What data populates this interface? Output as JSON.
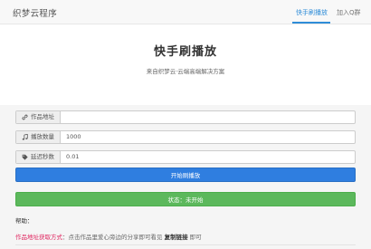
{
  "navbar": {
    "brand": "织梦云程序",
    "active_link": "快手刷播放",
    "other_link": "加入Q群"
  },
  "header": {
    "title": "快手刷播放",
    "subtitle": "来自织梦云·云端高端解决方案"
  },
  "form": {
    "work_url": {
      "label": "作品地址",
      "value": "",
      "icon": "link-icon"
    },
    "play_count": {
      "label": "播放数量",
      "value": "1000",
      "icon": "music-icon"
    },
    "delay_seconds": {
      "label": "延迟秒数",
      "value": "0.01",
      "icon": "tag-icon"
    }
  },
  "buttons": {
    "start_label": "开始刷播放",
    "status_label": "状态：未开始"
  },
  "help": {
    "title": "帮助：",
    "key": "作品地址获取方式",
    "text_before": "：点击作品里爱心旁边的分享即可看见",
    "strong": "复制链接",
    "text_after": "即可"
  },
  "colors": {
    "primary": "#2f7ee0",
    "success": "#5cb85c",
    "active_nav": "#2f8dd8",
    "help_key": "#e0245e"
  }
}
